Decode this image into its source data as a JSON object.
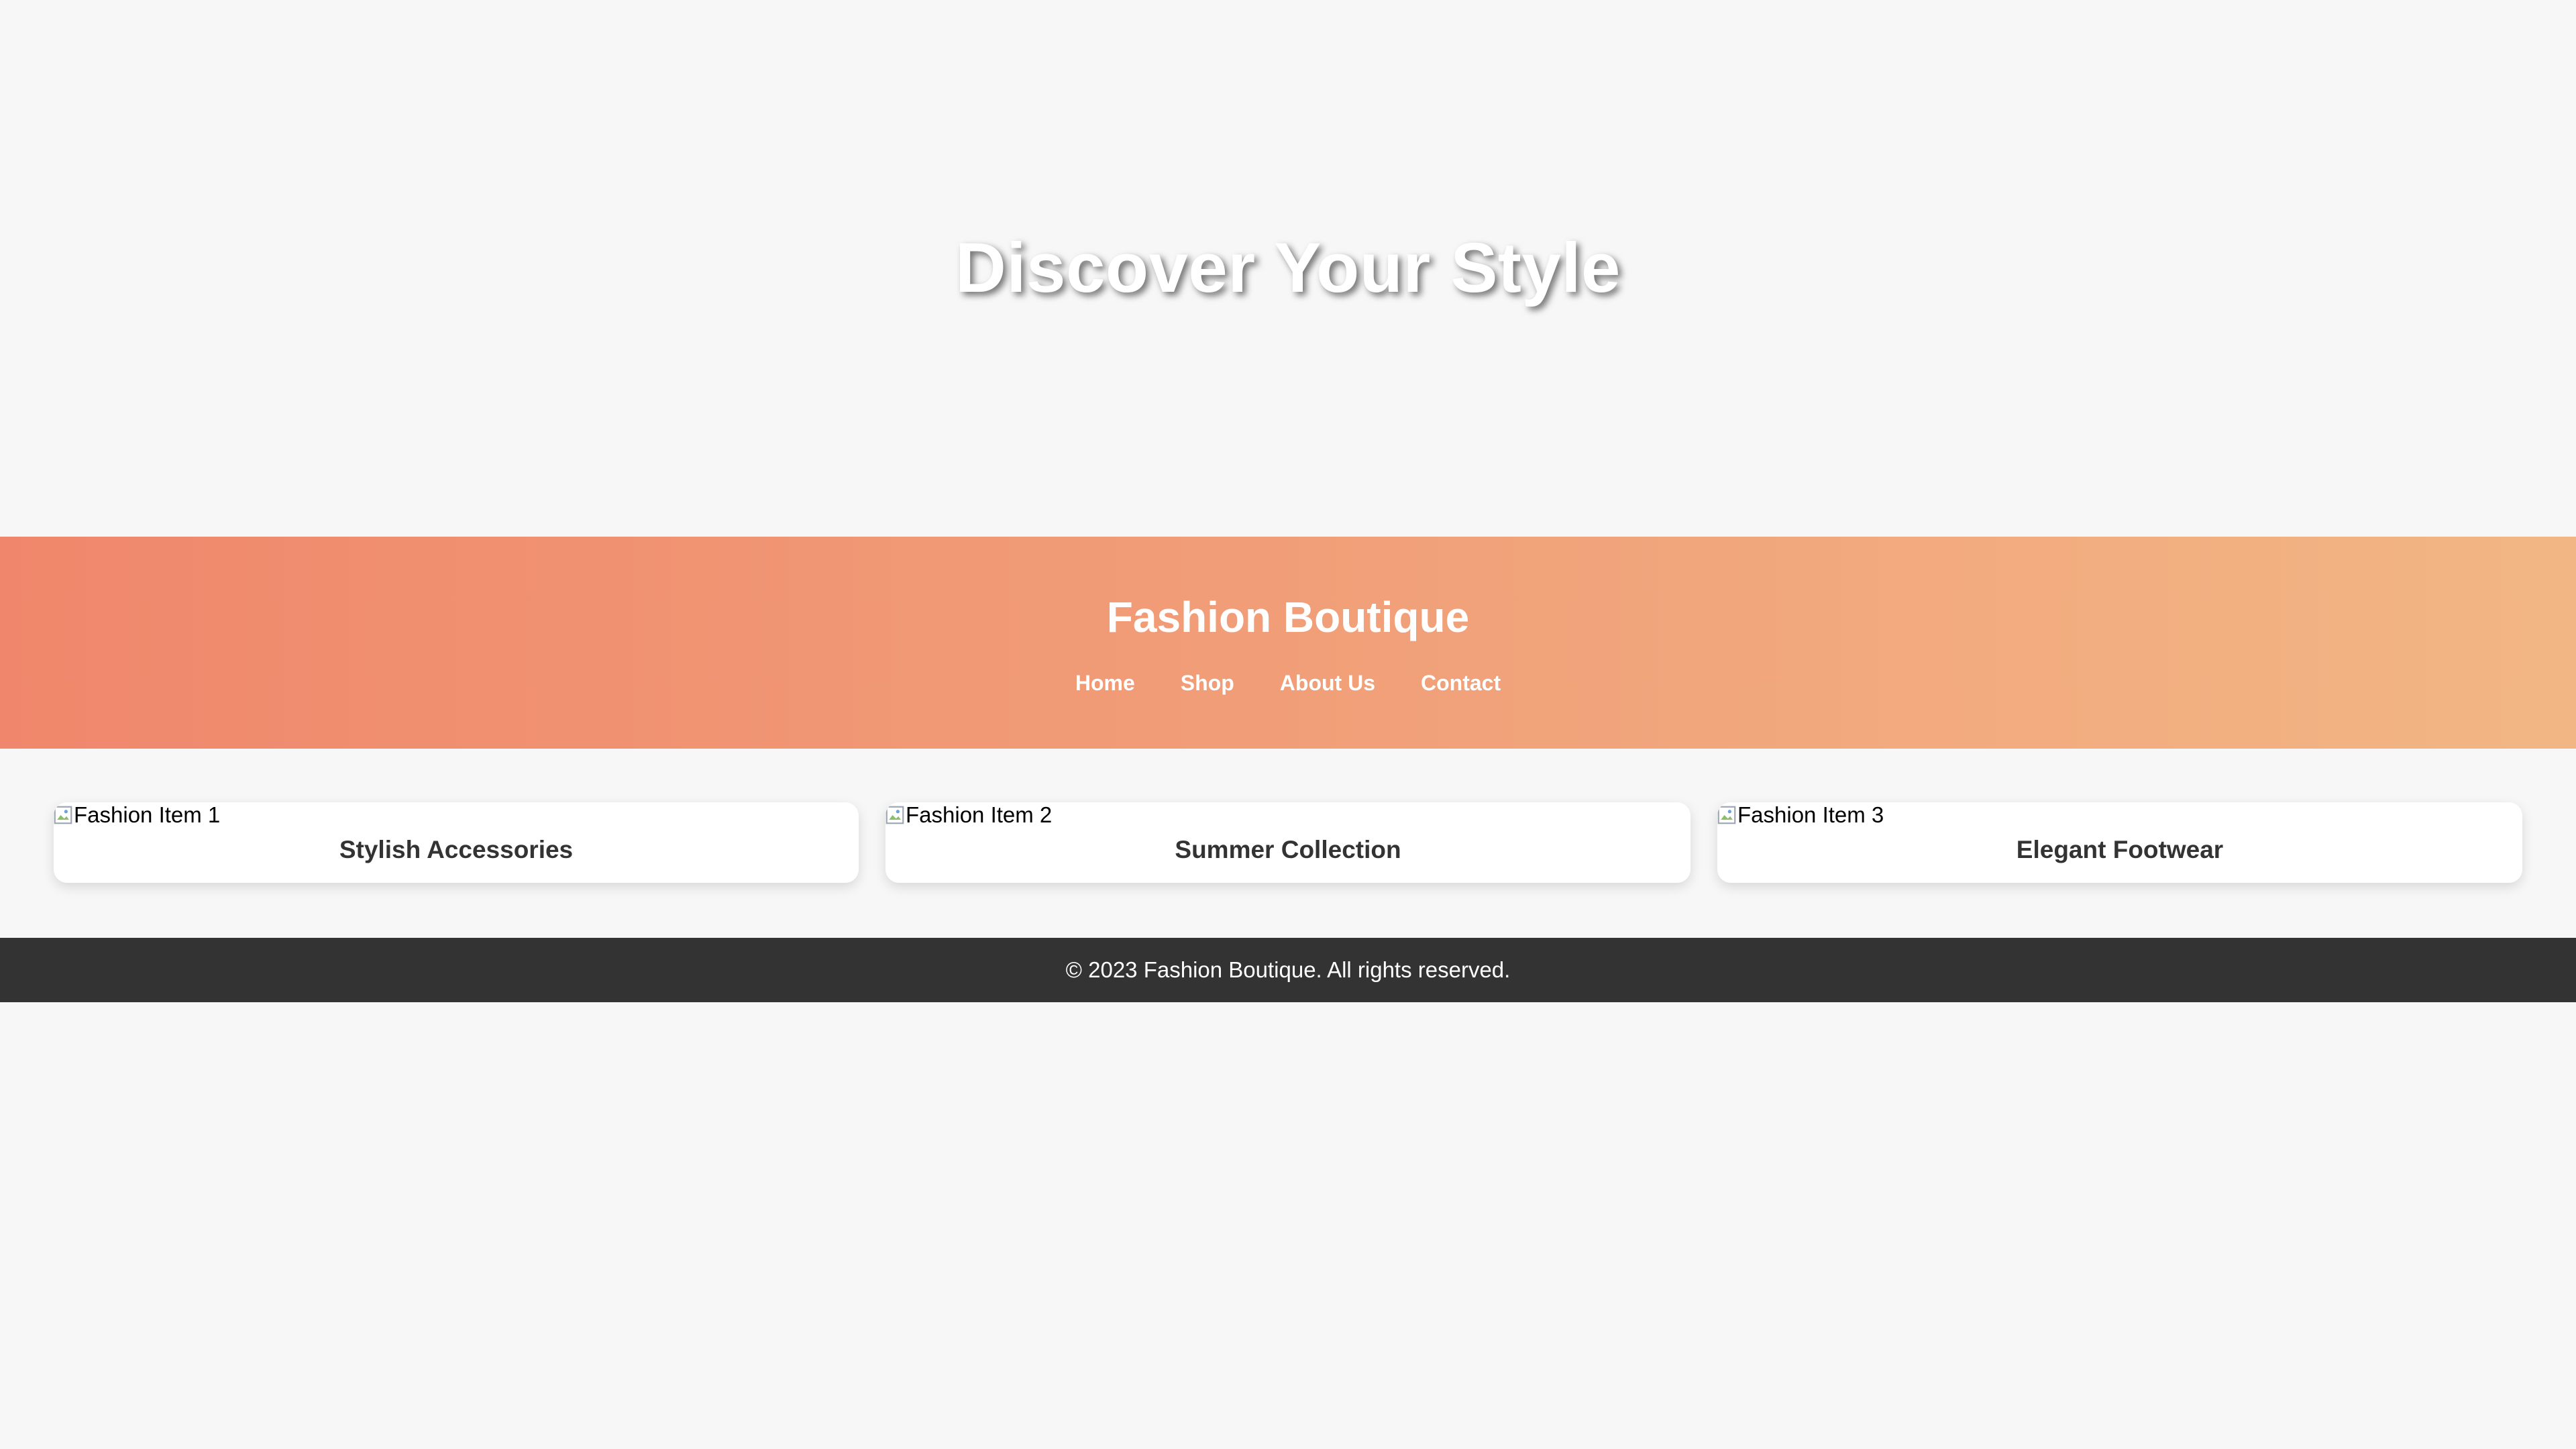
{
  "hero": {
    "headline": "Discover Your Style"
  },
  "header": {
    "brand": "Fashion Boutique",
    "gradient_start": "#f0876c",
    "gradient_end": "#f2b684",
    "nav": [
      {
        "label": "Home"
      },
      {
        "label": "Shop"
      },
      {
        "label": "About Us"
      },
      {
        "label": "Contact"
      }
    ]
  },
  "products": [
    {
      "image_alt": "Fashion Item 1",
      "title": "Stylish Accessories",
      "image_icon": "broken-image-icon"
    },
    {
      "image_alt": "Fashion Item 2",
      "title": "Summer Collection",
      "image_icon": "broken-image-icon"
    },
    {
      "image_alt": "Fashion Item 3",
      "title": "Elegant Footwear",
      "image_icon": "broken-image-icon"
    }
  ],
  "footer": {
    "copyright": "© 2023 Fashion Boutique. All rights reserved.",
    "background": "#333333"
  },
  "colors": {
    "page_background": "#f7f7f7",
    "text": "#333333",
    "card_background": "#ffffff"
  }
}
